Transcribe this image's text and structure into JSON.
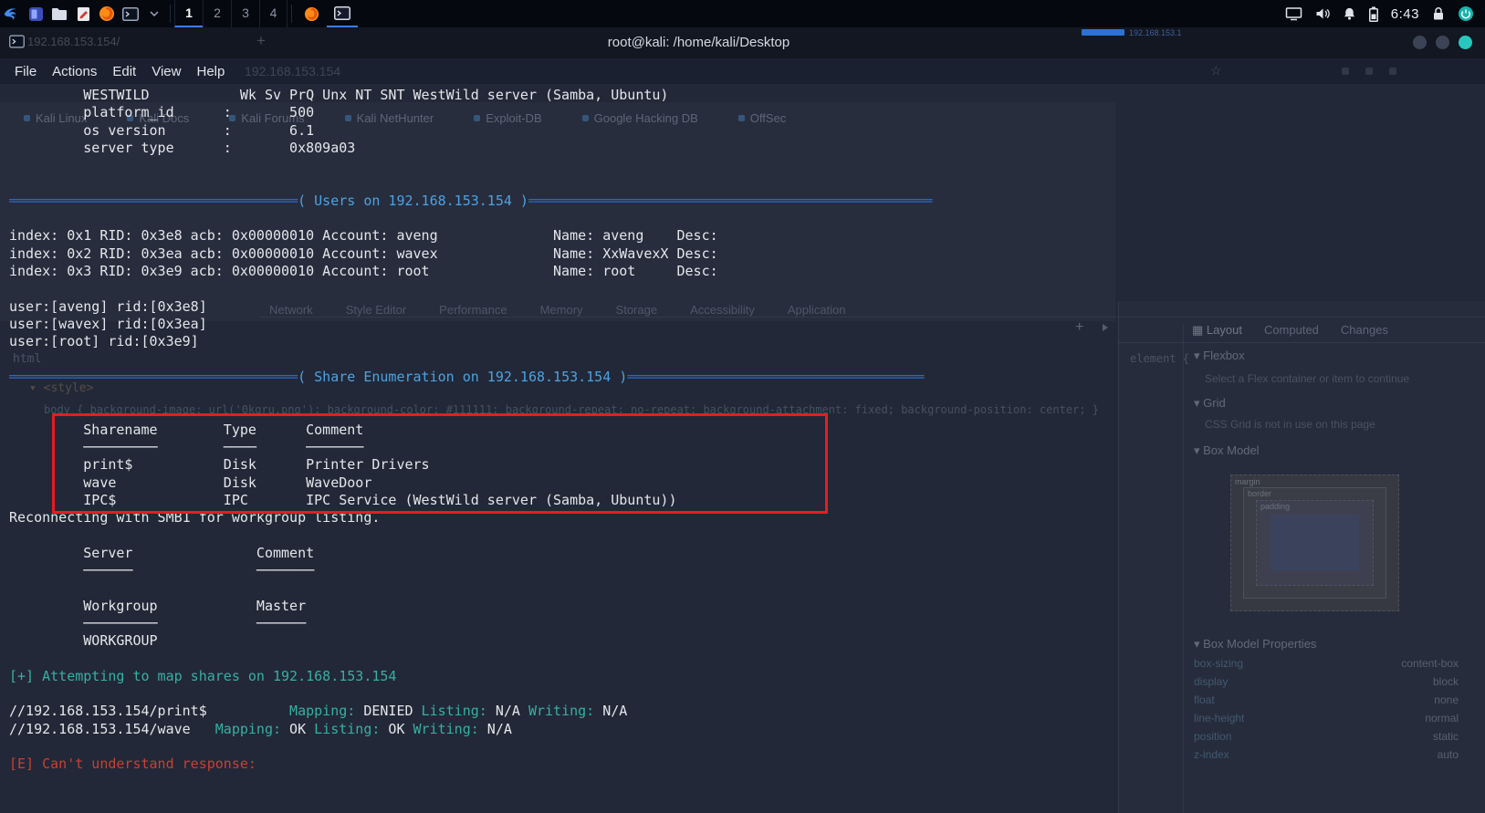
{
  "panel": {
    "workspaces": [
      "1",
      "2",
      "3",
      "4"
    ],
    "active_workspace": "1",
    "clock": "6:43",
    "left_icons": [
      "kali-menu",
      "desktop",
      "file-manager",
      "text-editor",
      "firefox",
      "terminal",
      "chevron-down"
    ],
    "task_icons": [
      "firefox",
      "terminal"
    ],
    "status_icons": [
      "display",
      "volume",
      "notifications",
      "battery",
      "clock",
      "screen-lock",
      "power"
    ]
  },
  "window": {
    "title": "root@kali: /home/kali/Desktop",
    "menu": [
      "File",
      "Actions",
      "Edit",
      "View",
      "Help"
    ],
    "buttons": [
      "minimize",
      "maximize",
      "close"
    ]
  },
  "terminal": {
    "lines": [
      [
        [
          "fg",
          "         WESTWILD           Wk Sv PrQ Unx NT SNT WestWild server (Samba, Ubuntu)"
        ]
      ],
      [
        [
          "fg",
          "         platform_id      :       500"
        ]
      ],
      [
        [
          "fg",
          "         os version       :       6.1"
        ]
      ],
      [
        [
          "fg",
          "         server type      :       0x809a03"
        ]
      ],
      [],
      [],
      [
        [
          "blue",
          "═══════════════════════════════════"
        ],
        [
          "cyan",
          "( Users on 192.168.153.154 )"
        ],
        [
          "blue",
          "═════════════════════════════════════════════════"
        ]
      ],
      [],
      [
        [
          "fg",
          "index: 0x1 RID: 0x3e8 acb: 0x00000010 Account: aveng              Name: aveng    Desc:"
        ]
      ],
      [
        [
          "fg",
          "index: 0x2 RID: 0x3ea acb: 0x00000010 Account: wavex              Name: XxWavexX Desc:"
        ]
      ],
      [
        [
          "fg",
          "index: 0x3 RID: 0x3e9 acb: 0x00000010 Account: root               Name: root     Desc:"
        ]
      ],
      [],
      [
        [
          "fg",
          "user:[aveng] rid:[0x3e8]"
        ]
      ],
      [
        [
          "fg",
          "user:[wavex] rid:[0x3ea]"
        ]
      ],
      [
        [
          "fg",
          "user:[root] rid:[0x3e9]"
        ]
      ],
      [],
      [
        [
          "blue",
          "═══════════════════════════════════"
        ],
        [
          "cyan",
          "( Share Enumeration on 192.168.153.154 )"
        ],
        [
          "blue",
          "════════════════════════════════════"
        ]
      ],
      [],
      [],
      [
        [
          "fg",
          "         Sharename        Type      Comment"
        ]
      ],
      [
        [
          "fg",
          "         ─────────        ────      ───────"
        ]
      ],
      [
        [
          "fg",
          "         print$           Disk      Printer Drivers"
        ]
      ],
      [
        [
          "fg",
          "         wave             Disk      WaveDoor"
        ]
      ],
      [
        [
          "fg",
          "         IPC$             IPC       IPC Service (WestWild server (Samba, Ubuntu))"
        ]
      ],
      [
        [
          "fg",
          "Reconnecting with SMB1 for workgroup listing."
        ]
      ],
      [],
      [
        [
          "fg",
          "         Server               Comment"
        ]
      ],
      [
        [
          "fg",
          "         ──────               ───────"
        ]
      ],
      [],
      [
        [
          "fg",
          "         Workgroup            Master"
        ]
      ],
      [
        [
          "fg",
          "         ─────────            ──────"
        ]
      ],
      [
        [
          "fg",
          "         WORKGROUP"
        ]
      ],
      [],
      [
        [
          "teal",
          "[+] Attempting to map shares on 192.168.153.154"
        ]
      ],
      [],
      [
        [
          "fg",
          "//192.168.153.154/print$          "
        ],
        [
          "teal",
          "Mapping:"
        ],
        [
          "fg",
          " DENIED "
        ],
        [
          "teal",
          "Listing:"
        ],
        [
          "fg",
          " N/A "
        ],
        [
          "teal",
          "Writing:"
        ],
        [
          "fg",
          " N/A"
        ]
      ],
      [
        [
          "fg",
          "//192.168.153.154/wave   "
        ],
        [
          "teal",
          "Mapping:"
        ],
        [
          "fg",
          " OK "
        ],
        [
          "teal",
          "Listing:"
        ],
        [
          "fg",
          " OK "
        ],
        [
          "teal",
          "Writing:"
        ],
        [
          "fg",
          " N/A"
        ]
      ],
      [],
      [
        [
          "red",
          "[E] Can't understand response:"
        ]
      ]
    ]
  },
  "annotation": {
    "color": "#e51c23"
  },
  "background": {
    "browser_tab": {
      "title": "192.168.153.154/",
      "new_tab_button": "+"
    },
    "address_bar": {
      "url": "192.168.153.154"
    },
    "overlay_text": "192.168.153.1",
    "bookmarks": [
      "Kali Linux",
      "Kali Docs",
      "Kali Forums",
      "Kali NetHunter",
      "Exploit-DB",
      "Google Hacking DB",
      "OffSec"
    ],
    "devtools": {
      "toolbar_items": [
        "Network",
        "Style Editor",
        "Performance",
        "Memory",
        "Storage",
        "Accessibility",
        "Application"
      ],
      "sidebar_tabs": [
        "Layout",
        "Computed",
        "Changes"
      ],
      "inspector": {
        "html_tag": "html",
        "style_tag": "▾ <style>",
        "css_rule": "body { background-image: url('0kgru.png'); background-color: #111111; background-repeat: no-repeat; background-attachment: fixed; background-position: center; }",
        "element_rule": "element {"
      },
      "layout_panel": {
        "flexbox_header": "▾ Flexbox",
        "flexbox_message": "Select a Flex container or item to continue",
        "grid_header": "▾ Grid",
        "grid_message": "CSS Grid is not in use on this page",
        "box_model_header": "▾ Box Model",
        "box_labels": [
          "margin",
          "border",
          "padding"
        ],
        "properties_header": "▾ Box Model Properties",
        "properties": [
          {
            "name": "box-sizing",
            "value": "content-box"
          },
          {
            "name": "display",
            "value": "block"
          },
          {
            "name": "float",
            "value": "none"
          },
          {
            "name": "line-height",
            "value": "normal"
          },
          {
            "name": "position",
            "value": "static"
          },
          {
            "name": "z-index",
            "value": "auto"
          }
        ]
      }
    }
  },
  "colors": {
    "terminal_bg": "#222837",
    "separator_blue": "#2c67c8",
    "header_cyan": "#4ba3e3",
    "status_teal": "#36b0a2",
    "error_red": "#c94034",
    "annotation_red": "#e51c23",
    "panel_accent_blue": "#3d7de8",
    "close_button_teal": "#27c7bd"
  }
}
